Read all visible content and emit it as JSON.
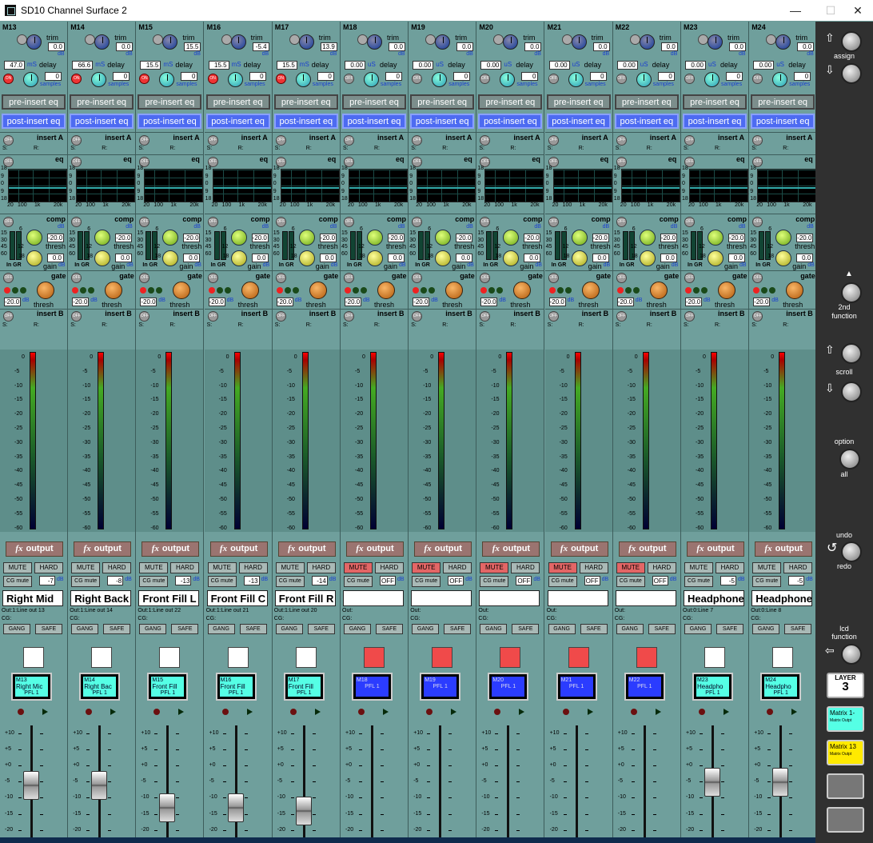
{
  "window": {
    "title": "SD10 Channel Surface 2",
    "minimize": "—",
    "maximize": "☐",
    "close": "✕"
  },
  "labels": {
    "trim": "trim",
    "db": "dB",
    "delay": "delay",
    "ms": "mS",
    "us": "uS",
    "samples": "samples",
    "on": "ON",
    "off": "OFF",
    "pre_insert_eq": "pre-insert eq",
    "post_insert_eq": "post-insert eq",
    "insert_a": "insert A",
    "insert_b": "insert B",
    "s": "S:",
    "r": "R:",
    "eq": "eq",
    "comp": "comp",
    "gate": "gate",
    "thresh": "thresh",
    "gain": "gain",
    "in_gr": "In GR",
    "fx_output": "output",
    "mute": "MUTE",
    "hard": "HARD",
    "cg_mute": "CG mute",
    "cg": "CG:",
    "gang": "GANG",
    "safe": "SAFE",
    "pfl": "PFL 1",
    "eq_scale": [
      "18",
      "9",
      "0",
      "9",
      "18"
    ],
    "eq_freq": [
      "20",
      "100",
      "1k",
      "20k"
    ],
    "comp_scale": [
      "15",
      "30",
      "45",
      "60"
    ],
    "comp_nums": [
      "6",
      "12",
      "18"
    ],
    "comp_thresh_val": "-20.0",
    "comp_gain_val": "0.0",
    "gate_thresh_val": "-20.0",
    "meter_scale": [
      "0",
      "-5",
      "-10",
      "-15",
      "-20",
      "-25",
      "-30",
      "-35",
      "-40",
      "-45",
      "-50",
      "-55",
      "-60"
    ],
    "fader_scale": [
      "+10",
      "+5",
      "+0",
      "-5",
      "-10",
      "-15",
      "-20"
    ]
  },
  "channels": [
    {
      "id": "M13",
      "trim": "0.0",
      "delay": "47.0",
      "delay_unit": "mS",
      "samples": "0",
      "on": true,
      "name": "Right Mid",
      "out": "Out:1:Line out 13",
      "muted": false,
      "cg": "-7",
      "lcd": [
        "M13",
        "Right Mic",
        "PFL 1"
      ],
      "lcd_color": "cyan",
      "sel_color": "#ffffff",
      "fader_db": -6
    },
    {
      "id": "M14",
      "trim": "0.0",
      "delay": "66.6",
      "delay_unit": "mS",
      "samples": "0",
      "on": true,
      "name": "Right Back",
      "out": "Out:1:Line out 14",
      "muted": false,
      "cg": "-8",
      "lcd": [
        "M14",
        "Right Bac",
        "PFL 1"
      ],
      "lcd_color": "cyan",
      "sel_color": "#ffffff",
      "fader_db": -6
    },
    {
      "id": "M15",
      "trim": "15.5",
      "delay": "15.5",
      "delay_unit": "mS",
      "samples": "0",
      "on": true,
      "name": "Front Fill L",
      "out": "Out:1:Line out 22",
      "muted": false,
      "cg": "-13",
      "lcd": [
        "M15",
        "Front Fill",
        "PFL 1"
      ],
      "lcd_color": "cyan",
      "sel_color": "#ffffff",
      "fader_db": -13
    },
    {
      "id": "M16",
      "trim": "-5.4",
      "delay": "15.5",
      "delay_unit": "mS",
      "samples": "0",
      "on": true,
      "name": "Front Fill C",
      "out": "Out:1:Line out 21",
      "muted": false,
      "cg": "-13",
      "lcd": [
        "M16",
        "Front Fill",
        "PFL 1"
      ],
      "lcd_color": "cyan",
      "sel_color": "#ffffff",
      "fader_db": -13
    },
    {
      "id": "M17",
      "trim": "13.9",
      "delay": "15.5",
      "delay_unit": "mS",
      "samples": "0",
      "on": true,
      "name": "Front Fill R",
      "out": "Out:1:Line out 20",
      "muted": false,
      "cg": "-14",
      "lcd": [
        "M17",
        "Front Fill",
        "PFL 1"
      ],
      "lcd_color": "cyan",
      "sel_color": "#ffffff",
      "fader_db": -14
    },
    {
      "id": "M18",
      "trim": "0.0",
      "delay": "0.00",
      "delay_unit": "uS",
      "samples": "0",
      "on": false,
      "name": "",
      "out": "Out:",
      "muted": true,
      "cg": "OFF",
      "lcd": [
        "M18",
        "",
        "PFL 1"
      ],
      "lcd_color": "blue",
      "sel_color": "#f04a4a",
      "fader_db": null
    },
    {
      "id": "M19",
      "trim": "0.0",
      "delay": "0.00",
      "delay_unit": "uS",
      "samples": "0",
      "on": false,
      "name": "",
      "out": "Out:",
      "muted": true,
      "cg": "OFF",
      "lcd": [
        "M19",
        "",
        "PFL 1"
      ],
      "lcd_color": "blue",
      "sel_color": "#f04a4a",
      "fader_db": null
    },
    {
      "id": "M20",
      "trim": "0.0",
      "delay": "0.00",
      "delay_unit": "uS",
      "samples": "0",
      "on": false,
      "name": "",
      "out": "Out:",
      "muted": true,
      "cg": "OFF",
      "lcd": [
        "M20",
        "",
        "PFL 1"
      ],
      "lcd_color": "blue",
      "sel_color": "#f04a4a",
      "fader_db": null
    },
    {
      "id": "M21",
      "trim": "0.0",
      "delay": "0.00",
      "delay_unit": "uS",
      "samples": "0",
      "on": false,
      "name": "",
      "out": "Out:",
      "muted": true,
      "cg": "OFF",
      "lcd": [
        "M21",
        "",
        "PFL 1"
      ],
      "lcd_color": "blue",
      "sel_color": "#f04a4a",
      "fader_db": null
    },
    {
      "id": "M22",
      "trim": "0.0",
      "delay": "0.00",
      "delay_unit": "uS",
      "samples": "0",
      "on": false,
      "name": "",
      "out": "Out:",
      "muted": true,
      "cg": "OFF",
      "lcd": [
        "M22",
        "",
        "PFL 1"
      ],
      "lcd_color": "blue",
      "sel_color": "#f04a4a",
      "fader_db": null
    },
    {
      "id": "M23",
      "trim": "0.0",
      "delay": "0.00",
      "delay_unit": "uS",
      "samples": "0",
      "on": false,
      "name": "Headphone",
      "out": "Out:0:Line 7",
      "muted": false,
      "cg": "-5",
      "lcd": [
        "M23",
        "Headpho",
        "PFL 1"
      ],
      "lcd_color": "cyan",
      "sel_color": "#ffffff",
      "fader_db": -5
    },
    {
      "id": "M24",
      "trim": "0.0",
      "delay": "0.00",
      "delay_unit": "uS",
      "samples": "0",
      "on": false,
      "name": "Headphone",
      "out": "Out:0:Line 8",
      "muted": false,
      "cg": "-5",
      "lcd": [
        "M24",
        "Headpho",
        "PFL 1"
      ],
      "lcd_color": "cyan",
      "sel_color": "#ffffff",
      "fader_db": -5
    }
  ],
  "side": {
    "assign": "assign",
    "second_function_sup": "2nd",
    "second_function": "function",
    "scroll": "scroll",
    "option": "option",
    "all": "all",
    "undo": "undo",
    "redo": "redo",
    "lcd_function": [
      "lcd",
      "function"
    ],
    "layer_label": "LAYER",
    "layer_value": "3",
    "matrix1": [
      "Matrix 1-",
      "Matrix Outpt"
    ],
    "matrix13": [
      "Matrix 13",
      "Matrix Outpt"
    ]
  }
}
